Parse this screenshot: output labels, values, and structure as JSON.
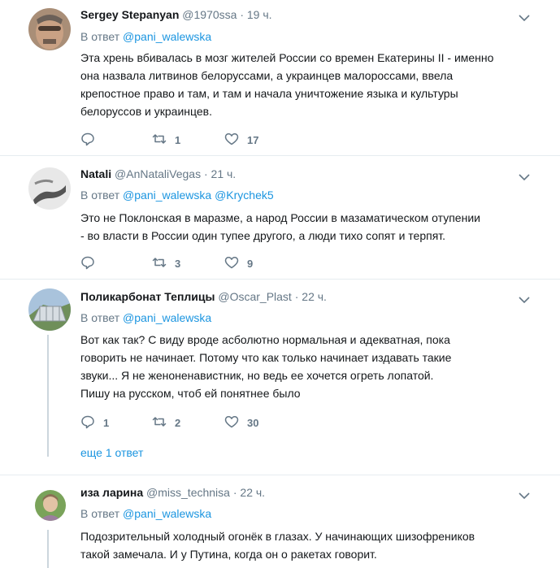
{
  "tweets": [
    {
      "name": "Sergey Stepanyan",
      "handle": "@1970ssa",
      "dot": "·",
      "time": "19 ч.",
      "reply_prefix": "В ответ",
      "reply_to": [
        "@pani_walewska"
      ],
      "lines": [
        "Эта хрень вбивалась в мозг жителей России со времен Екатерины II - именно",
        "она назвала литвинов белоруссами, а украинцев малороссами, ввела",
        "крепостное право и там, и там и начала уничтожение языка и культуры",
        "белоруссов и украинцев."
      ],
      "replies": "",
      "retweets": "1",
      "likes": "17"
    },
    {
      "name": "Natali",
      "handle": "@AnNataliVegas",
      "dot": "·",
      "time": "21 ч.",
      "reply_prefix": "В ответ",
      "reply_to": [
        "@pani_walewska",
        "@Krychek5"
      ],
      "lines": [
        "Это не Поклонская в маразме, а народ России в мазаматическом отупении",
        "- во власти в России один тупее другого, а люди тихо сопят и терпят."
      ],
      "replies": "",
      "retweets": "3",
      "likes": "9"
    },
    {
      "name": "Поликарбонат Теплицы",
      "handle": "@Oscar_Plast",
      "dot": "·",
      "time": "22 ч.",
      "reply_prefix": "В ответ",
      "reply_to": [
        "@pani_walewska"
      ],
      "lines": [
        "Вот как так? С виду вроде асболютно нормальная и адекватная, пока",
        "говорить не начинает. Потому что как только начинает издавать такие",
        "звуки... Я не женоненавистник, но ведь ее хочется огреть лопатой.",
        "Пишу на русском, чтоб ей понятнее было"
      ],
      "replies": "1",
      "retweets": "2",
      "likes": "30",
      "more_replies": "еще 1 ответ"
    },
    {
      "name": "иза ларина",
      "handle": "@miss_technisa",
      "dot": "·",
      "time": "22 ч.",
      "reply_prefix": "В ответ",
      "reply_to": [
        "@pani_walewska"
      ],
      "lines": [
        "Подозрительный холодный огонёк в глазах.  У начинающих шизофреников",
        "такой замечала. И у Путина, когда он о ракетах говорит."
      ]
    }
  ],
  "colors": {
    "link": "#1b95e0",
    "muted": "#657786",
    "text": "#14171a",
    "divider": "#e6ecf0"
  },
  "icons": [
    "reply-icon",
    "retweet-icon",
    "like-icon",
    "chevron-down-icon"
  ]
}
